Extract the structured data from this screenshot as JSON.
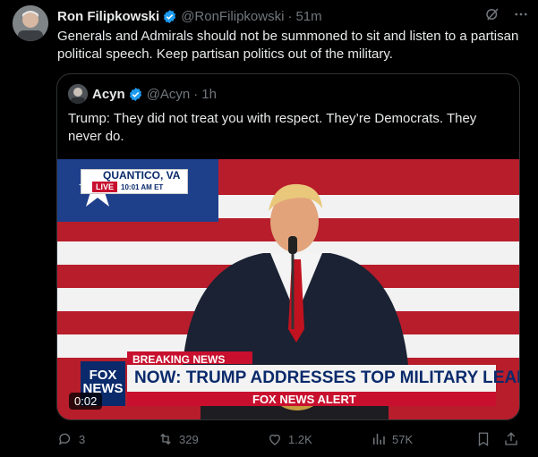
{
  "tweet": {
    "author_name": "Ron Filipkowski",
    "handle": "@RonFilipkowski",
    "time": "51m",
    "text": "Generals and Admirals should not be summoned to sit and listen to a partisan political speech. Keep partisan politics out of the military."
  },
  "quote": {
    "author_name": "Acyn",
    "handle": "@Acyn",
    "time": "1h",
    "text": "Trump: They did not treat you with respect. They’re Democrats. They never do."
  },
  "video": {
    "location": "QUANTICO, VA",
    "live_label": "LIVE",
    "clock": "10:01 AM ET",
    "breaking_label": "BREAKING NEWS",
    "headline": "NOW: TRUMP ADDRESSES TOP MILITARY LEADERS",
    "network_logo": "FOX NEWS",
    "alert_label": "FOX NEWS ALERT",
    "duration": "0:02"
  },
  "actions": {
    "replies": "3",
    "reposts": "329",
    "likes": "1.2K",
    "views": "57K"
  },
  "colors": {
    "background": "#000000",
    "text": "#e7e9ea",
    "muted": "#71767b",
    "verified": "#1d9bf0",
    "border": "#2f3336",
    "fox_red": "#c8102e",
    "fox_blue": "#0a2a6b"
  }
}
